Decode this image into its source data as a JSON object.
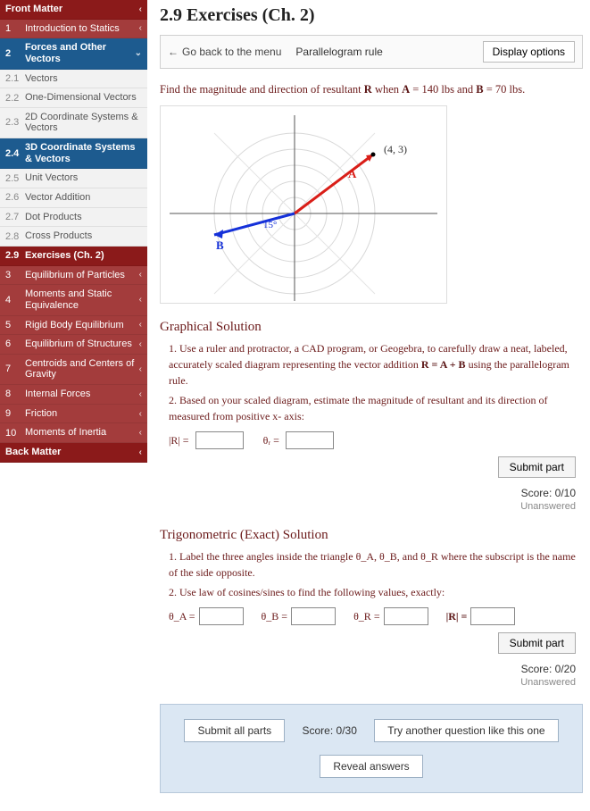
{
  "sidebar": {
    "front": "Front Matter",
    "s1": "Introduction to Statics",
    "s2": "Forces and Other Vectors",
    "s21": "Vectors",
    "n21": "2.1",
    "s22": "One-Dimensional Vectors",
    "n22": "2.2",
    "s23": "2D Coordinate Systems & Vectors",
    "n23": "2.3",
    "s24": "3D Coordinate Systems & Vectors",
    "n24": "2.4",
    "s25": "Unit Vectors",
    "n25": "2.5",
    "s26": "Vector Addition",
    "n26": "2.6",
    "s27": "Dot Products",
    "n27": "2.7",
    "s28": "Cross Products",
    "n28": "2.8",
    "s29": "Exercises (Ch. 2)",
    "n29": "2.9",
    "s3": "Equilibrium of Particles",
    "s4": "Moments and Static Equivalence",
    "s5": "Rigid Body Equilibrium",
    "s6": "Equilibrium of Structures",
    "s7": "Centroids and Centers of Gravity",
    "s8": "Internal Forces",
    "s9": "Friction",
    "s10": "Moments of Inertia",
    "back": "Back Matter",
    "n1": "1",
    "n2": "2",
    "n3": "3",
    "n4": "4",
    "n5": "5",
    "n6": "6",
    "n7": "7",
    "n8": "8",
    "n9": "9",
    "n10": "10"
  },
  "title": "2.9 Exercises (Ch. 2)",
  "topbar": {
    "back": "Go back to the menu",
    "crumb": "Parallelogram rule",
    "display": "Display options"
  },
  "prompt": {
    "pre": "Find the magnitude and direction of resultant ",
    "R": "R",
    "mid1": " when ",
    "A": "A",
    "eqA": " = 140 lbs and ",
    "B": "B",
    "eqB": " = 70 lbs."
  },
  "diagram": {
    "pointLabel": "(4, 3)",
    "Alabel": "A",
    "Blabel": "B",
    "angle": "15°"
  },
  "graphical": {
    "heading": "Graphical Solution",
    "step1a": "1. Use a ruler and protractor, a CAD program, or Geogebra, to carefully draw a neat, labeled, accurately scaled diagram representing the vector addition ",
    "eq": "R = A + B",
    "step1b": " using the parallelogram rule.",
    "step2": "2. Based on your scaled diagram,  estimate the magnitude of resultant and its direction of measured from positive x- axis:",
    "Rlabel": "|R| =",
    "thetaLabel": "θᵣ  =",
    "submit": "Submit part",
    "score": "Score: 0/10",
    "status": "Unanswered"
  },
  "trig": {
    "heading": "Trigonometric (Exact) Solution",
    "step1": "1. Label the three angles inside the triangle θ_A, θ_B, and θ_R where the subscript is the name of the side opposite.",
    "step2": "2. Use law of cosines/sines to find the following values, exactly:",
    "tA": "θ_A =",
    "tB": "θ_B =",
    "tR": "θ_R =",
    "tMag": "|R| =",
    "submit": "Submit part",
    "score": "Score: 0/20",
    "status": "Unanswered"
  },
  "footer": {
    "submitAll": "Submit all parts",
    "score": "Score: 0/30",
    "tryAnother": "Try another question like this one",
    "reveal": "Reveal answers"
  },
  "chart_data": {
    "type": "vector-diagram",
    "title": "Parallelogram rule vector addition",
    "x_range": [
      -6,
      6
    ],
    "y_range": [
      -5,
      5
    ],
    "grid": "polar-overlay on cartesian axes",
    "vectors": [
      {
        "name": "A",
        "color": "#d91e18",
        "tip": [
          4,
          3
        ],
        "magnitude_lbs": 140,
        "label_pos": [
          3.3,
          2.0
        ]
      },
      {
        "name": "B",
        "color": "#1531d9",
        "tip": [
          -3.8,
          -1.0
        ],
        "magnitude_lbs": 70,
        "angle_below_neg_x_deg": 15,
        "label_pos": [
          -3.5,
          -1.3
        ]
      }
    ],
    "marked_point": {
      "coords": [
        4,
        3
      ],
      "label": "(4, 3)"
    },
    "annotation_angle": {
      "value_deg": 15,
      "near": "origin, below negative x-axis"
    }
  }
}
